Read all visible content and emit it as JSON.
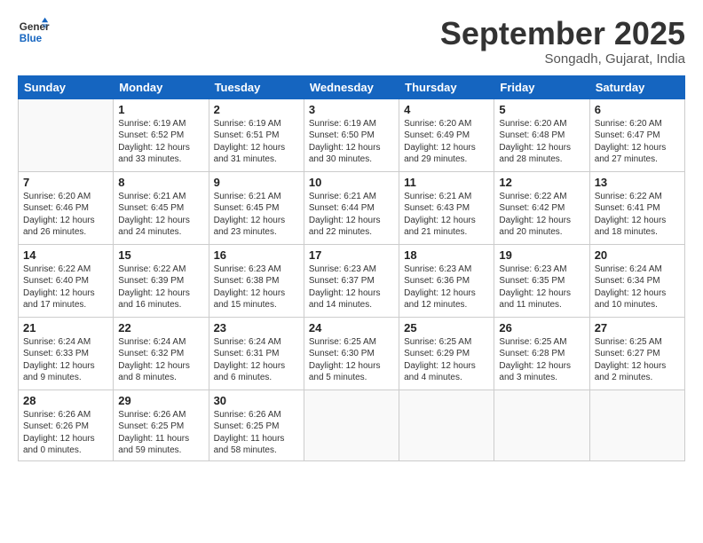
{
  "logo": {
    "line1": "General",
    "line2": "Blue"
  },
  "header": {
    "month": "September 2025",
    "location": "Songadh, Gujarat, India"
  },
  "days_of_week": [
    "Sunday",
    "Monday",
    "Tuesday",
    "Wednesday",
    "Thursday",
    "Friday",
    "Saturday"
  ],
  "weeks": [
    [
      {
        "day": "",
        "info": ""
      },
      {
        "day": "1",
        "info": "Sunrise: 6:19 AM\nSunset: 6:52 PM\nDaylight: 12 hours\nand 33 minutes."
      },
      {
        "day": "2",
        "info": "Sunrise: 6:19 AM\nSunset: 6:51 PM\nDaylight: 12 hours\nand 31 minutes."
      },
      {
        "day": "3",
        "info": "Sunrise: 6:19 AM\nSunset: 6:50 PM\nDaylight: 12 hours\nand 30 minutes."
      },
      {
        "day": "4",
        "info": "Sunrise: 6:20 AM\nSunset: 6:49 PM\nDaylight: 12 hours\nand 29 minutes."
      },
      {
        "day": "5",
        "info": "Sunrise: 6:20 AM\nSunset: 6:48 PM\nDaylight: 12 hours\nand 28 minutes."
      },
      {
        "day": "6",
        "info": "Sunrise: 6:20 AM\nSunset: 6:47 PM\nDaylight: 12 hours\nand 27 minutes."
      }
    ],
    [
      {
        "day": "7",
        "info": "Sunrise: 6:20 AM\nSunset: 6:46 PM\nDaylight: 12 hours\nand 26 minutes."
      },
      {
        "day": "8",
        "info": "Sunrise: 6:21 AM\nSunset: 6:45 PM\nDaylight: 12 hours\nand 24 minutes."
      },
      {
        "day": "9",
        "info": "Sunrise: 6:21 AM\nSunset: 6:45 PM\nDaylight: 12 hours\nand 23 minutes."
      },
      {
        "day": "10",
        "info": "Sunrise: 6:21 AM\nSunset: 6:44 PM\nDaylight: 12 hours\nand 22 minutes."
      },
      {
        "day": "11",
        "info": "Sunrise: 6:21 AM\nSunset: 6:43 PM\nDaylight: 12 hours\nand 21 minutes."
      },
      {
        "day": "12",
        "info": "Sunrise: 6:22 AM\nSunset: 6:42 PM\nDaylight: 12 hours\nand 20 minutes."
      },
      {
        "day": "13",
        "info": "Sunrise: 6:22 AM\nSunset: 6:41 PM\nDaylight: 12 hours\nand 18 minutes."
      }
    ],
    [
      {
        "day": "14",
        "info": "Sunrise: 6:22 AM\nSunset: 6:40 PM\nDaylight: 12 hours\nand 17 minutes."
      },
      {
        "day": "15",
        "info": "Sunrise: 6:22 AM\nSunset: 6:39 PM\nDaylight: 12 hours\nand 16 minutes."
      },
      {
        "day": "16",
        "info": "Sunrise: 6:23 AM\nSunset: 6:38 PM\nDaylight: 12 hours\nand 15 minutes."
      },
      {
        "day": "17",
        "info": "Sunrise: 6:23 AM\nSunset: 6:37 PM\nDaylight: 12 hours\nand 14 minutes."
      },
      {
        "day": "18",
        "info": "Sunrise: 6:23 AM\nSunset: 6:36 PM\nDaylight: 12 hours\nand 12 minutes."
      },
      {
        "day": "19",
        "info": "Sunrise: 6:23 AM\nSunset: 6:35 PM\nDaylight: 12 hours\nand 11 minutes."
      },
      {
        "day": "20",
        "info": "Sunrise: 6:24 AM\nSunset: 6:34 PM\nDaylight: 12 hours\nand 10 minutes."
      }
    ],
    [
      {
        "day": "21",
        "info": "Sunrise: 6:24 AM\nSunset: 6:33 PM\nDaylight: 12 hours\nand 9 minutes."
      },
      {
        "day": "22",
        "info": "Sunrise: 6:24 AM\nSunset: 6:32 PM\nDaylight: 12 hours\nand 8 minutes."
      },
      {
        "day": "23",
        "info": "Sunrise: 6:24 AM\nSunset: 6:31 PM\nDaylight: 12 hours\nand 6 minutes."
      },
      {
        "day": "24",
        "info": "Sunrise: 6:25 AM\nSunset: 6:30 PM\nDaylight: 12 hours\nand 5 minutes."
      },
      {
        "day": "25",
        "info": "Sunrise: 6:25 AM\nSunset: 6:29 PM\nDaylight: 12 hours\nand 4 minutes."
      },
      {
        "day": "26",
        "info": "Sunrise: 6:25 AM\nSunset: 6:28 PM\nDaylight: 12 hours\nand 3 minutes."
      },
      {
        "day": "27",
        "info": "Sunrise: 6:25 AM\nSunset: 6:27 PM\nDaylight: 12 hours\nand 2 minutes."
      }
    ],
    [
      {
        "day": "28",
        "info": "Sunrise: 6:26 AM\nSunset: 6:26 PM\nDaylight: 12 hours\nand 0 minutes."
      },
      {
        "day": "29",
        "info": "Sunrise: 6:26 AM\nSunset: 6:25 PM\nDaylight: 11 hours\nand 59 minutes."
      },
      {
        "day": "30",
        "info": "Sunrise: 6:26 AM\nSunset: 6:25 PM\nDaylight: 11 hours\nand 58 minutes."
      },
      {
        "day": "",
        "info": ""
      },
      {
        "day": "",
        "info": ""
      },
      {
        "day": "",
        "info": ""
      },
      {
        "day": "",
        "info": ""
      }
    ]
  ]
}
